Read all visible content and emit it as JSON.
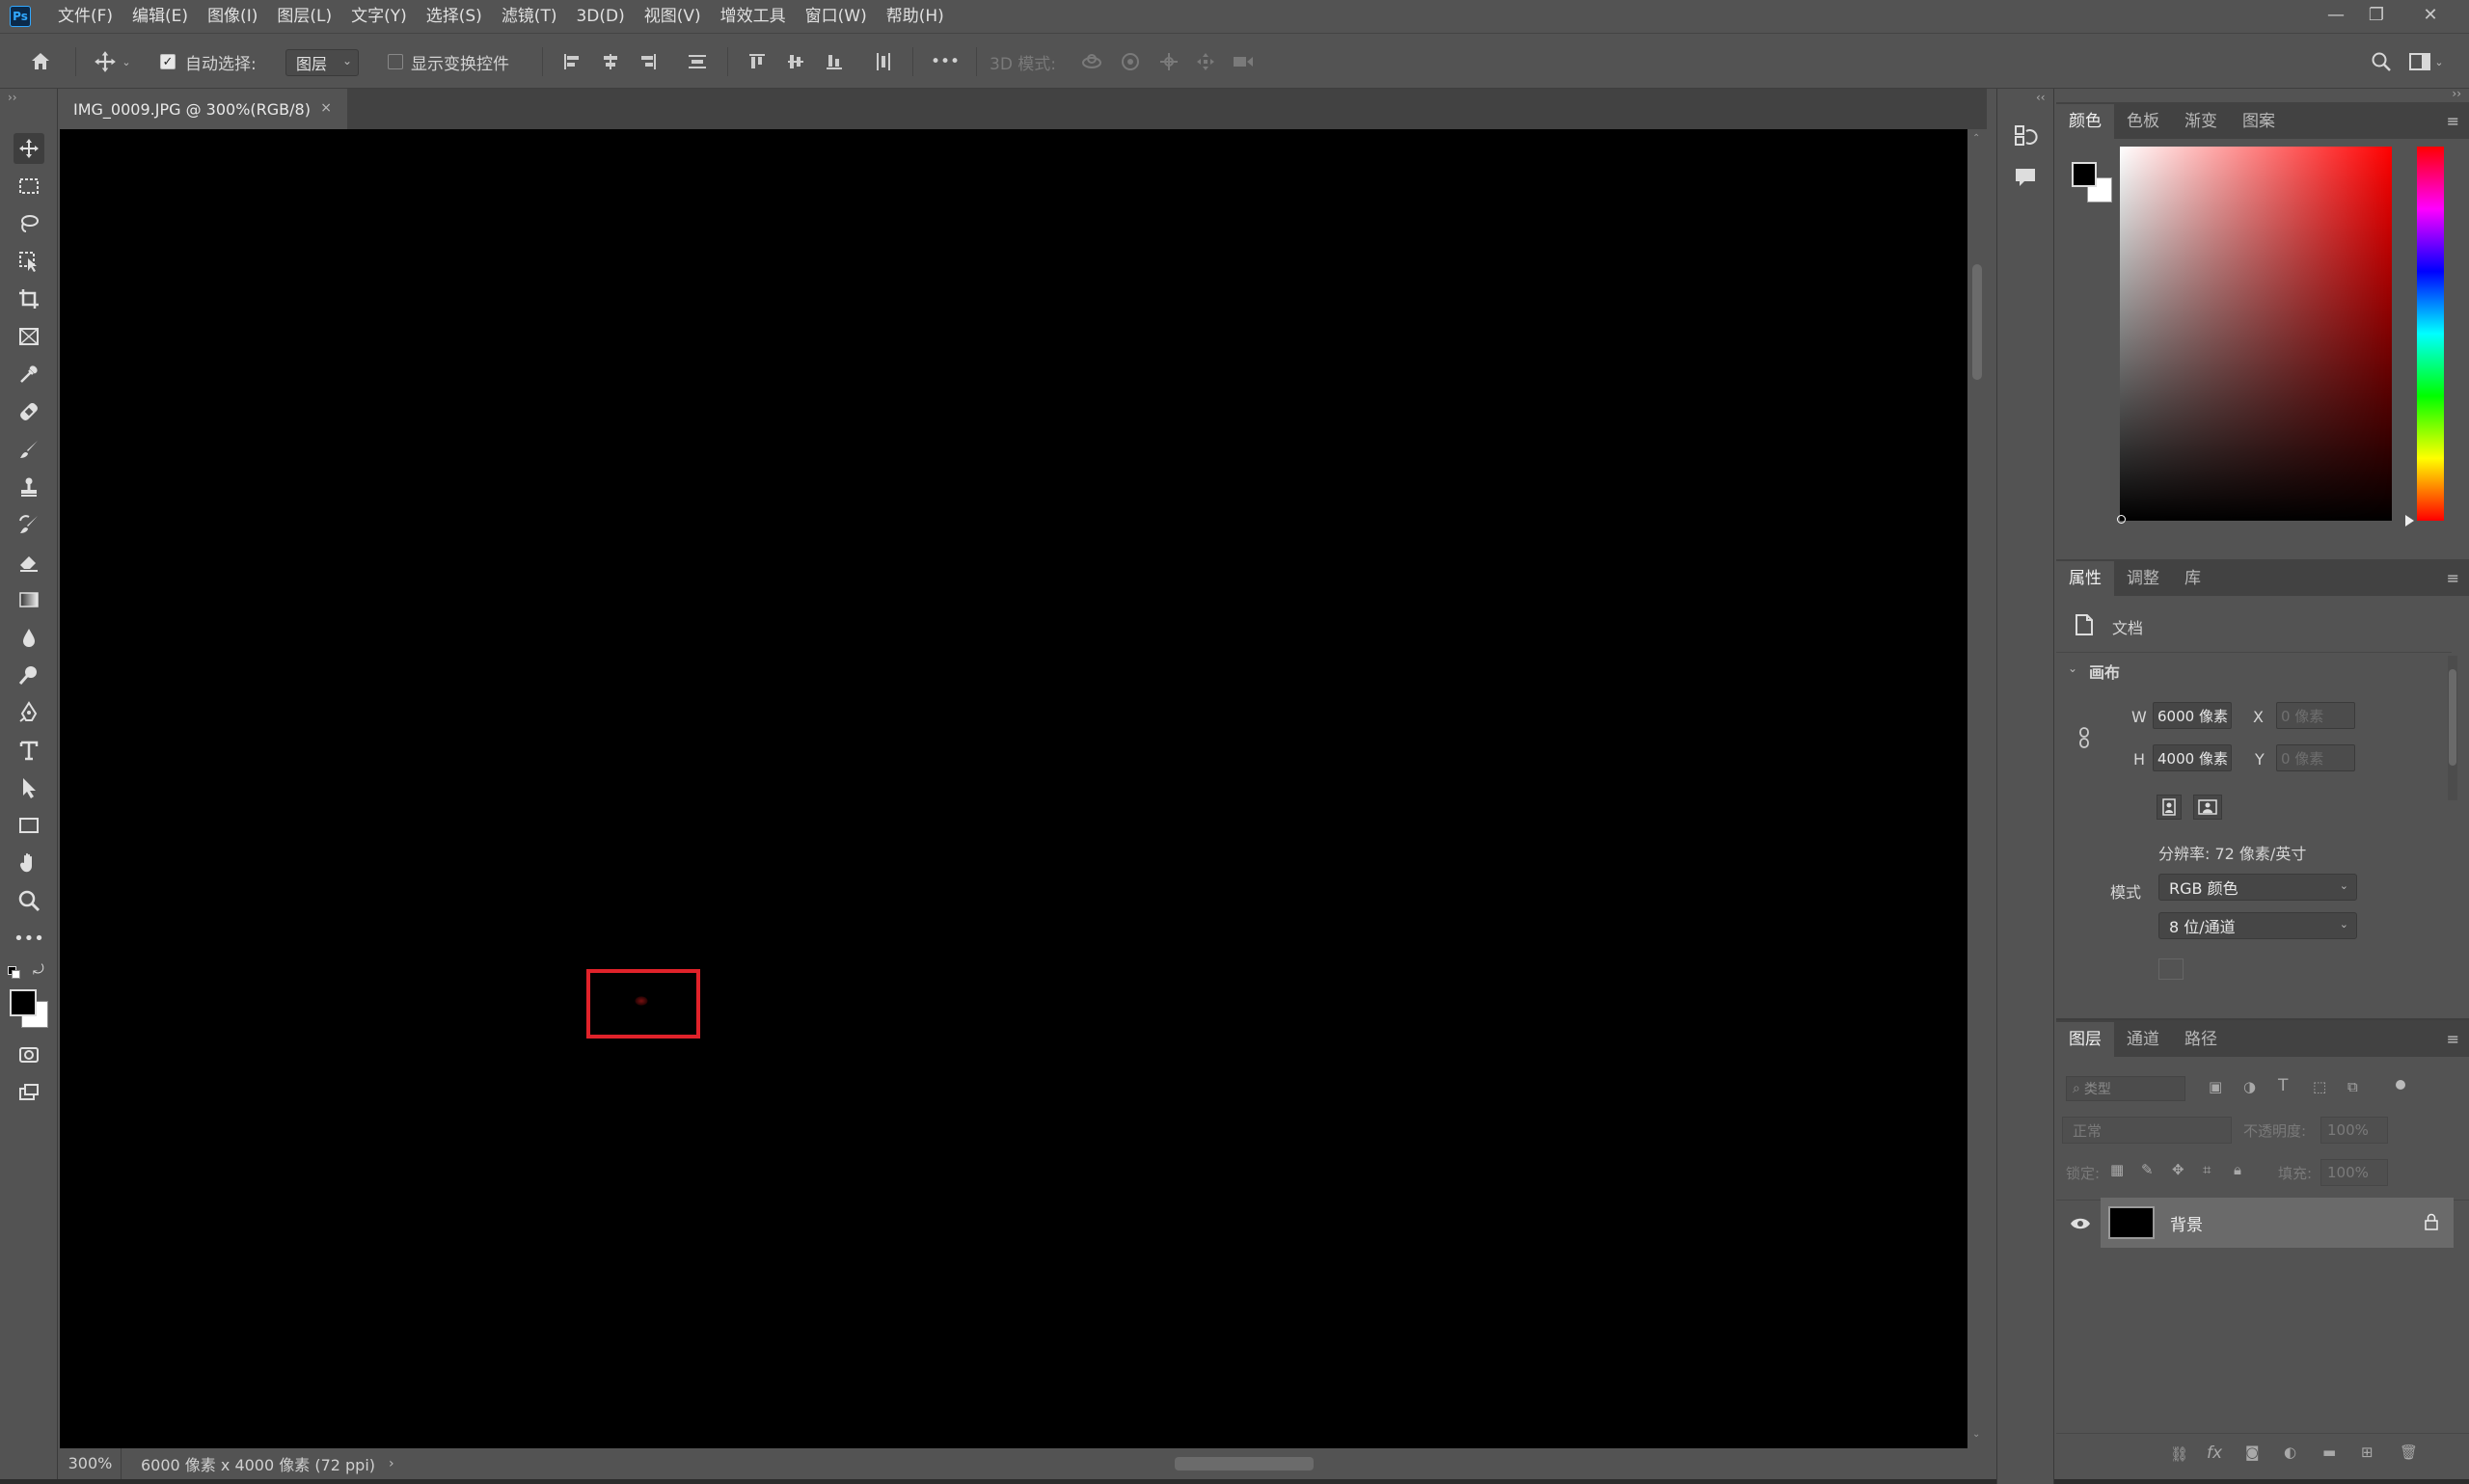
{
  "menubar": {
    "logo": "Ps",
    "items": [
      "文件(F)",
      "编辑(E)",
      "图像(I)",
      "图层(L)",
      "文字(Y)",
      "选择(S)",
      "滤镜(T)",
      "3D(D)",
      "视图(V)",
      "增效工具",
      "窗口(W)",
      "帮助(H)"
    ]
  },
  "optionsbar": {
    "auto_select_label": "自动选择:",
    "auto_select_value": "图层",
    "show_transform_label": "显示变换控件",
    "more": "•••",
    "mode3d_label": "3D 模式:"
  },
  "document": {
    "tab_title": "IMG_0009.JPG @ 300%(RGB/8)",
    "close": "×",
    "marker_color": "#e0222a",
    "canvas_color": "#000000"
  },
  "status": {
    "zoom": "300%",
    "info": "6000 像素 x 4000 像素 (72 ppi)"
  },
  "color_panel": {
    "tabs": [
      "颜色",
      "色板",
      "渐变",
      "图案"
    ],
    "fg": "#000000",
    "bg": "#ffffff",
    "hue": "#ff0000"
  },
  "properties_panel": {
    "tabs": [
      "属性",
      "调整",
      "库"
    ],
    "doc_label": "文档",
    "section": "画布",
    "w_label": "W",
    "w_value": "6000 像素",
    "h_label": "H",
    "h_value": "4000 像素",
    "x_label": "X",
    "x_value": "0 像素",
    "y_label": "Y",
    "y_value": "0 像素",
    "resolution": "分辨率: 72 像素/英寸",
    "mode_label": "模式",
    "mode_value": "RGB 颜色",
    "depth_value": "8 位/通道"
  },
  "layers_panel": {
    "tabs": [
      "图层",
      "通道",
      "路径"
    ],
    "filter_placeholder": "类型",
    "blend_mode": "正常",
    "opacity_label": "不透明度:",
    "opacity_value": "100%",
    "lock_label": "锁定:",
    "fill_label": "填充:",
    "fill_value": "100%",
    "layer_name": "背景"
  }
}
